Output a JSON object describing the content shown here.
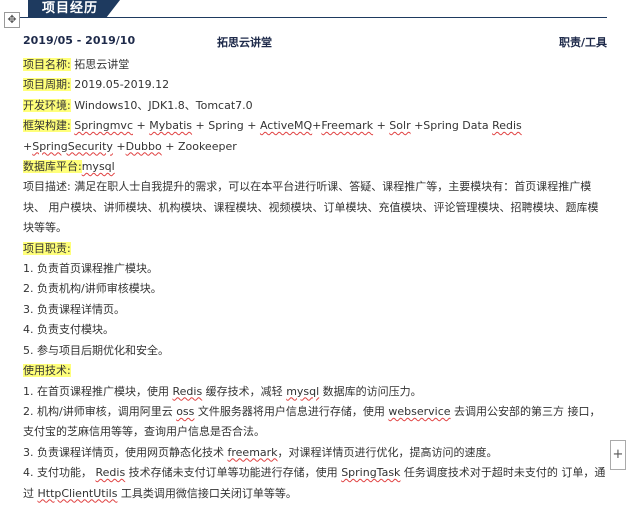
{
  "header": {
    "title": "项目经历",
    "move_glyph": "✥",
    "add_glyph": "+"
  },
  "summary": {
    "date_range": "2019/05 - 2019/10",
    "project_name": "拓思云讲堂",
    "role": "职责/工具"
  },
  "details": {
    "name_label": "项目名称:",
    "name_value": "拓思云讲堂",
    "period_label": "项目周期:",
    "period_value": "2019.05-2019.12",
    "env_label": "开发环境:",
    "env_value": "Windows10、JDK1.8、Tomcat7.0",
    "framework_label": "框架构建:",
    "framework_parts": [
      "Springmvc",
      " + ",
      "Mybatis",
      " + Spring + ",
      "ActiveMQ",
      "+",
      "Freemark",
      " + ",
      "Solr",
      " +Spring Data ",
      "Redis"
    ],
    "framework_line2_parts": [
      "+",
      "SpringSecurity",
      " +",
      "Dubbo",
      " + Zookeeper"
    ],
    "db_label": "数据库平台:",
    "db_value": "mysql",
    "desc": "项目描述: 满足在职人士自我提升的需求，可以在本平台进行听课、答疑、课程推广等，主要模块有：首页课程推广模块、 用户模块、讲师模块、机构模块、课程模块、视频模块、订单模块、充值模块、评论管理模块、招聘模块、题库模 块等等。"
  },
  "duties": {
    "label": "项目职责:",
    "items": [
      "1. 负责首页课程推广模块。",
      "2. 负责机构/讲师审核模块。",
      "3. 负责课程详情页。",
      "4. 负责支付模块。",
      "5. 参与项目后期优化和安全。"
    ]
  },
  "tech": {
    "label": "使用技术:",
    "item1": [
      "1.   在首页课程推广模块，使用 ",
      "Redis",
      " 缓存技术，减轻 ",
      "mysql",
      " 数据库的访问压力。"
    ],
    "item2": [
      "2.   机构/讲师审核，调用阿里云 ",
      "oss",
      " 文件服务器将用户信息进行存储，使用 ",
      "webservice",
      " 去调用公安部的第三方 接口，支付宝的芝麻信用等等，查询用户信息是否合法。"
    ],
    "item3": [
      "3.   负责课程详情页，使用网页静态化技术 ",
      "freemark",
      "，对课程详情页进行优化，提高访问的速度。"
    ],
    "item4": [
      "4.   支付功能，  ",
      "Redis",
      " 技术存储未支付订单等功能进行存储，使用 ",
      "SpringTask",
      " 任务调度技术对于超时未支付的 订单，通过 ",
      "HttpClientUtils",
      " 工具类调用微信接口关闭订单等等。"
    ]
  },
  "colors": {
    "header_bg": "#1e3a5f",
    "highlight": "#ffff7a",
    "spell_underline": "#e04040"
  }
}
